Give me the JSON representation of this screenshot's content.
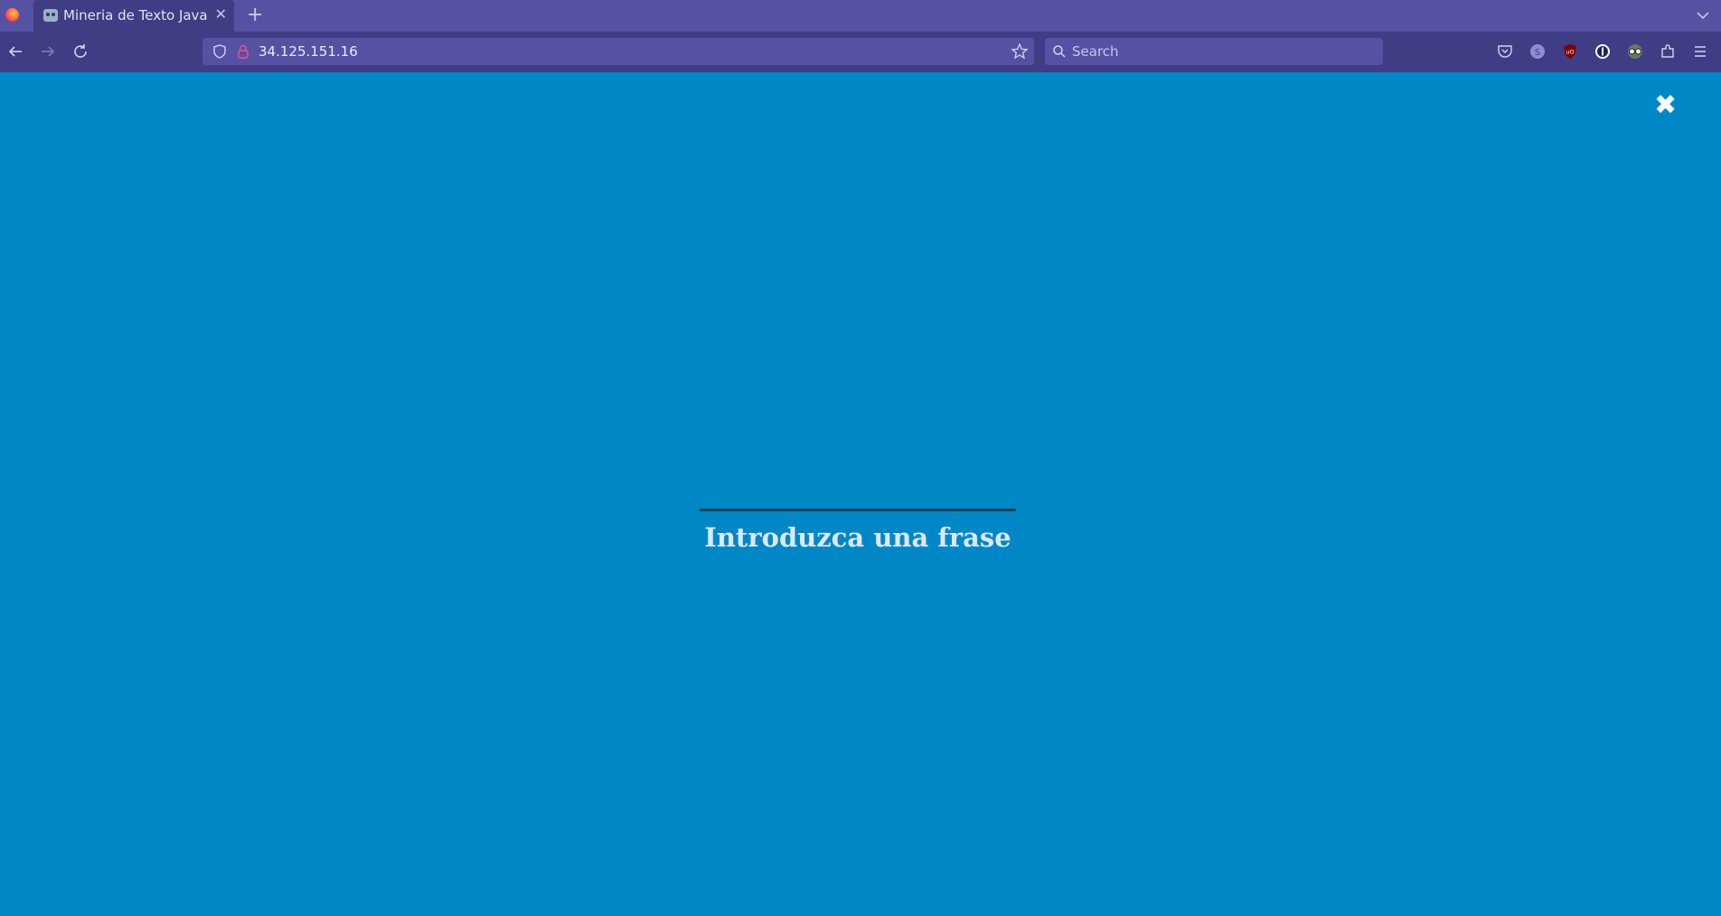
{
  "browser": {
    "tab": {
      "title": "Mineria de Texto Java"
    },
    "url": "34.125.151.16",
    "search_placeholder": "Search",
    "icons": {
      "firefox": "firefox-logo-icon",
      "favicon": "robot-favicon-icon",
      "tab_close": "close-icon",
      "new_tab": "plus-icon",
      "tab_list": "chevron-down-icon",
      "back": "arrow-left-icon",
      "forward": "arrow-right-icon",
      "reload": "reload-icon",
      "tracking": "shield-icon",
      "connection": "lock-icon",
      "bookmark": "star-icon",
      "search": "search-icon",
      "pocket": "pocket-icon",
      "ext1": "extension-s-icon",
      "ublock": "ublock-origin-icon",
      "onepassword": "1password-icon",
      "ext_glasses": "glasses-extension-icon",
      "extensions": "puzzle-icon",
      "menu": "hamburger-menu-icon"
    }
  },
  "page": {
    "close_symbol": "✖",
    "input_value": "",
    "prompt": "Introduzca una frase"
  },
  "colors": {
    "page_background": "#0088c6",
    "toolbar": "#3f3d84",
    "tabstrip": "#5552a4",
    "input_underline": "#1d3d52",
    "prompt_text": "#dde8f0"
  }
}
